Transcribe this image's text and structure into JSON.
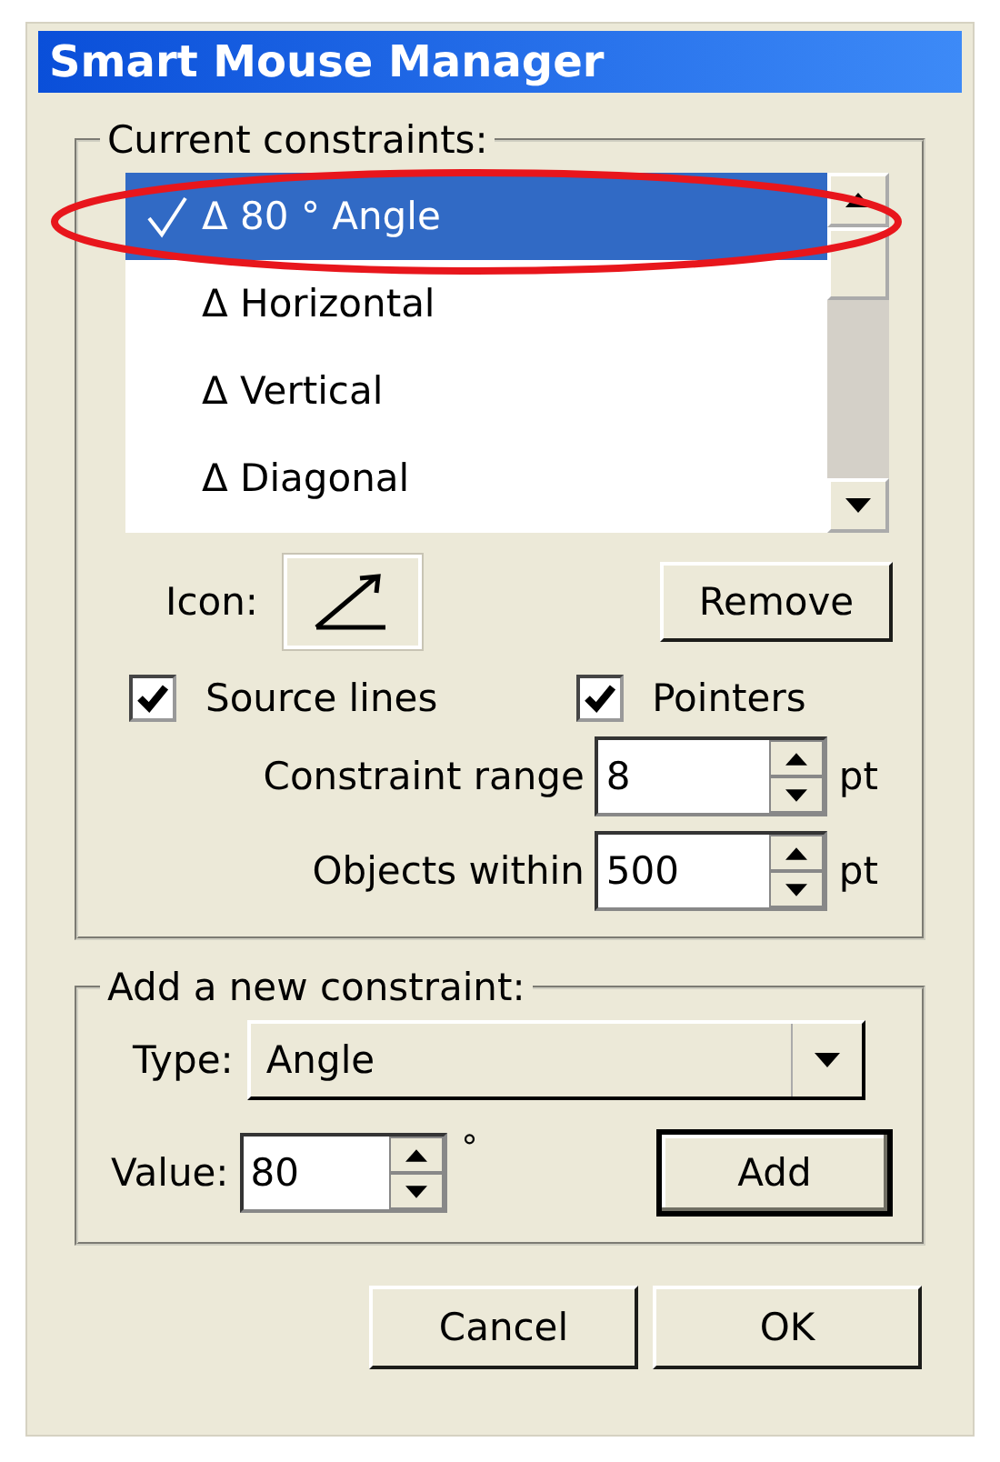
{
  "window": {
    "title": "Smart Mouse Manager"
  },
  "constraints_group": {
    "label": "Current constraints:",
    "items": [
      {
        "text": "Δ 80 ° Angle",
        "checked": true,
        "selected": true
      },
      {
        "text": "Δ Horizontal",
        "checked": false,
        "selected": false
      },
      {
        "text": "Δ Vertical",
        "checked": false,
        "selected": false
      },
      {
        "text": "Δ Diagonal",
        "checked": false,
        "selected": false
      }
    ],
    "icon_label": "Icon:",
    "remove_button": "Remove",
    "checkboxes": [
      {
        "label": "Source lines",
        "checked": true
      },
      {
        "label": "Pointers",
        "checked": true
      }
    ],
    "spinners": [
      {
        "label": "Constraint range",
        "value": "8",
        "unit": "pt"
      },
      {
        "label": "Objects within",
        "value": "500",
        "unit": "pt"
      }
    ]
  },
  "add_group": {
    "label": "Add a new constraint:",
    "type_label": "Type:",
    "type_value": "Angle",
    "value_label": "Value:",
    "value": "80",
    "value_unit": "°",
    "add_button": {
      "label": "Add",
      "default": true
    }
  },
  "buttons": [
    "Cancel",
    "OK"
  ]
}
